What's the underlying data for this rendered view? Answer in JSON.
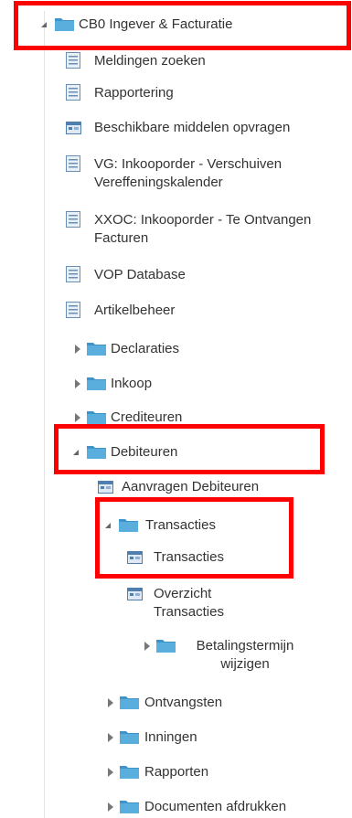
{
  "tree": {
    "root": {
      "label": "CB0 Ingever & Facturatie",
      "icon": "folder-icon"
    },
    "root_children": [
      {
        "label": "Meldingen zoeken",
        "icon": "document-list-icon"
      },
      {
        "label": "Rapportering",
        "icon": "document-list-icon"
      },
      {
        "label": "Beschikbare middelen opvragen",
        "icon": "form-app-icon"
      },
      {
        "label": "VG: Inkooporder - Verschuiven Vereffeningskalender",
        "icon": "document-list-icon"
      },
      {
        "label": "XXOC: Inkooporder - Te Ontvangen Facturen",
        "icon": "document-list-icon"
      },
      {
        "label": "VOP Database",
        "icon": "document-list-icon"
      },
      {
        "label": "Artikelbeheer",
        "icon": "document-list-icon"
      }
    ],
    "folders": [
      {
        "label": "Declaraties"
      },
      {
        "label": "Inkoop"
      },
      {
        "label": "Crediteuren"
      }
    ],
    "debiteuren": {
      "label": "Debiteuren",
      "children": {
        "aanvragen": "Aanvragen Debiteuren",
        "transacties_folder": "Transacties",
        "transacties_item": "Transacties",
        "overzicht": "Overzicht Transacties",
        "betalingstermijn": "Betalingstermijn wijzigen",
        "ontvangsten": "Ontvangsten",
        "inningen": "Inningen",
        "rapporten": "Rapporten",
        "documenten": "Documenten afdrukken"
      }
    }
  },
  "colors": {
    "folder": "#5aaede",
    "folder_dark": "#3e93c9",
    "doc": "#6a8fb6",
    "highlight": "#ff0000",
    "guide_line": "#e4e4e4"
  }
}
